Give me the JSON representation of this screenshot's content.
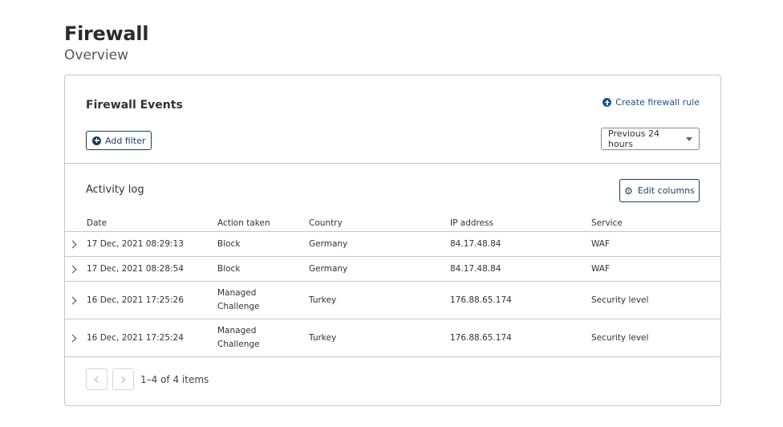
{
  "page": {
    "title": "Firewall",
    "subtitle": "Overview"
  },
  "events": {
    "title": "Firewall Events",
    "create_rule_label": "Create firewall rule",
    "add_filter_label": "Add filter",
    "time_range": "Previous 24 hours"
  },
  "activity": {
    "title": "Activity log",
    "edit_columns_label": "Edit columns",
    "columns": [
      "Date",
      "Action taken",
      "Country",
      "IP address",
      "Service"
    ],
    "rows": [
      {
        "date": "17 Dec, 2021 08:29:13",
        "action": "Block",
        "country": "Germany",
        "ip": "84.17.48.84",
        "service": "WAF"
      },
      {
        "date": "17 Dec, 2021 08:28:54",
        "action": "Block",
        "country": "Germany",
        "ip": "84.17.48.84",
        "service": "WAF"
      },
      {
        "date": "16 Dec, 2021 17:25:26",
        "action": "Managed Challenge",
        "country": "Turkey",
        "ip": "176.88.65.174",
        "service": "Security level"
      },
      {
        "date": "16 Dec, 2021 17:25:24",
        "action": "Managed Challenge",
        "country": "Turkey",
        "ip": "176.88.65.174",
        "service": "Security level"
      }
    ]
  },
  "pagination": {
    "summary": "1–4 of 4 items"
  },
  "colors": {
    "accent": "#1d4f91",
    "button_border": "#1d3b5e",
    "border": "#c7c7c7"
  }
}
